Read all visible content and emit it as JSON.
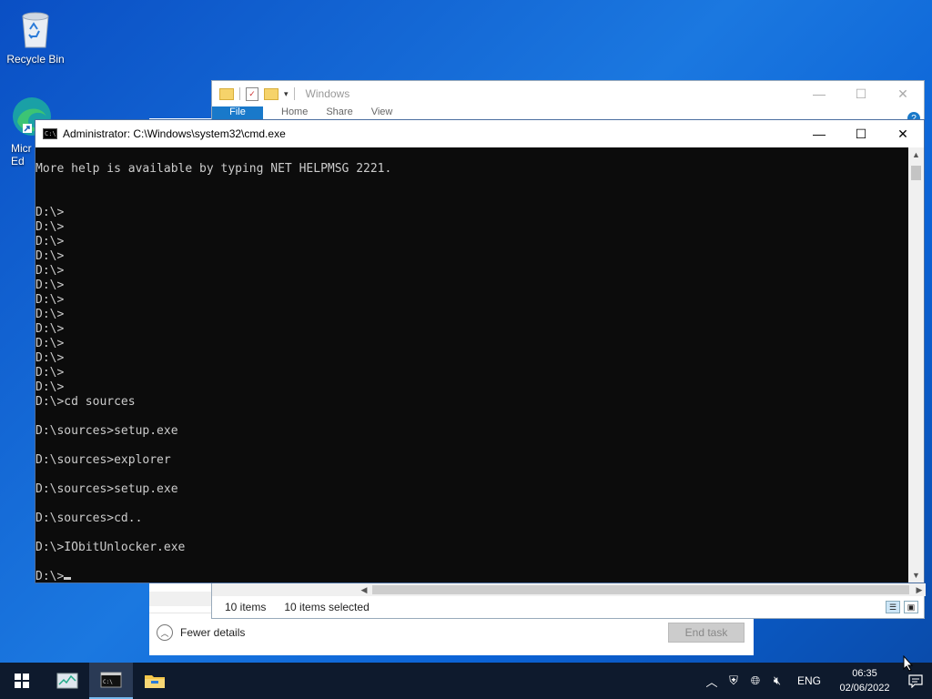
{
  "desktop": {
    "icons": [
      {
        "label": "Recycle Bin",
        "icon": "recycle-bin-icon"
      },
      {
        "label": "Micr\nEd",
        "icon": "edge-icon"
      }
    ]
  },
  "task_manager": {
    "fewer_details": "Fewer details",
    "end_task": "End task"
  },
  "explorer": {
    "title": "Windows",
    "ribbon_tabs": [
      "File",
      "Home",
      "Share",
      "View"
    ],
    "status_items": "10 items",
    "status_selected": "10 items selected",
    "help": "?"
  },
  "cmd": {
    "title": "Administrator: C:\\Windows\\system32\\cmd.exe",
    "lines": [
      "More help is available by typing NET HELPMSG 2221.",
      "",
      "",
      "D:\\>",
      "D:\\>",
      "D:\\>",
      "D:\\>",
      "D:\\>",
      "D:\\>",
      "D:\\>",
      "D:\\>",
      "D:\\>",
      "D:\\>",
      "D:\\>",
      "D:\\>",
      "D:\\>",
      "D:\\>cd sources",
      "",
      "D:\\sources>setup.exe",
      "",
      "D:\\sources>explorer",
      "",
      "D:\\sources>setup.exe",
      "",
      "D:\\sources>cd..",
      "",
      "D:\\>IObitUnlocker.exe",
      "",
      "D:\\>"
    ]
  },
  "taskbar": {
    "apps": [
      {
        "name": "task-manager-icon",
        "active": false
      },
      {
        "name": "cmd-icon",
        "active": true
      },
      {
        "name": "file-explorer-icon",
        "active": false
      }
    ],
    "language": "ENG",
    "time": "06:35",
    "date": "02/06/2022"
  },
  "colors": {
    "console_bg": "#0c0c0c",
    "console_fg": "#cccccc",
    "taskbar_bg": "#0e1a2d",
    "accent": "#1979ca"
  }
}
